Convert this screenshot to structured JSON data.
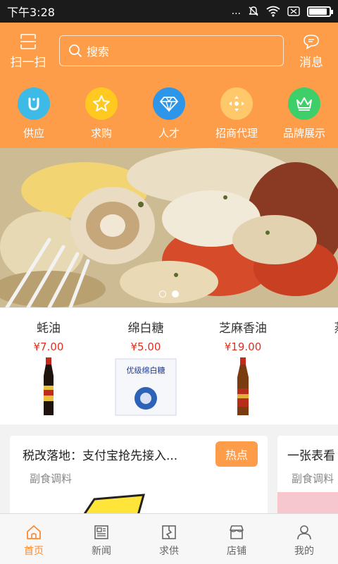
{
  "status_bar": {
    "time": "下午3:28",
    "dots": "...",
    "wifi_icon": "wifi-icon",
    "battery_icon": "battery-icon",
    "battery_level": 0.9
  },
  "header": {
    "scan_label": "扫一扫",
    "search_placeholder": "搜索",
    "message_label": "消息",
    "categories": [
      {
        "label": "供应",
        "icon": "u-icon",
        "color": "#3dbbe6"
      },
      {
        "label": "求购",
        "icon": "star-icon",
        "color": "#ffc91f"
      },
      {
        "label": "人才",
        "icon": "diamond-icon",
        "color": "#2d96e8"
      },
      {
        "label": "招商代理",
        "icon": "arrows-icon",
        "color": "#ffc86a"
      },
      {
        "label": "品牌展示",
        "icon": "crown-icon",
        "color": "#3fcf6a"
      }
    ]
  },
  "banner": {
    "slides": 2,
    "active_slide": 2
  },
  "products": [
    {
      "name": "蚝油",
      "price": "¥7.00"
    },
    {
      "name": "绵白糖",
      "price": "¥5.00",
      "pack_text": "优级绵白糖"
    },
    {
      "name": "芝麻香油",
      "price": "¥19.00"
    },
    {
      "name": "蒸",
      "price": ""
    }
  ],
  "news": [
    {
      "title": "税改落地：支付宝抢先接入...",
      "tag": "热点",
      "category": "副食调料"
    },
    {
      "title": "一张表看",
      "category": "副食调料"
    }
  ],
  "tabbar": [
    {
      "label": "首页",
      "icon": "home-icon",
      "active": true
    },
    {
      "label": "新闻",
      "icon": "news-icon",
      "active": false
    },
    {
      "label": "求供",
      "icon": "supply-icon",
      "active": false
    },
    {
      "label": "店铺",
      "icon": "shop-icon",
      "active": false
    },
    {
      "label": "我的",
      "icon": "user-icon",
      "active": false
    }
  ],
  "colors": {
    "brand": "#fd9d4a",
    "price": "#e0301e",
    "active_tab": "#fd8a2f"
  }
}
